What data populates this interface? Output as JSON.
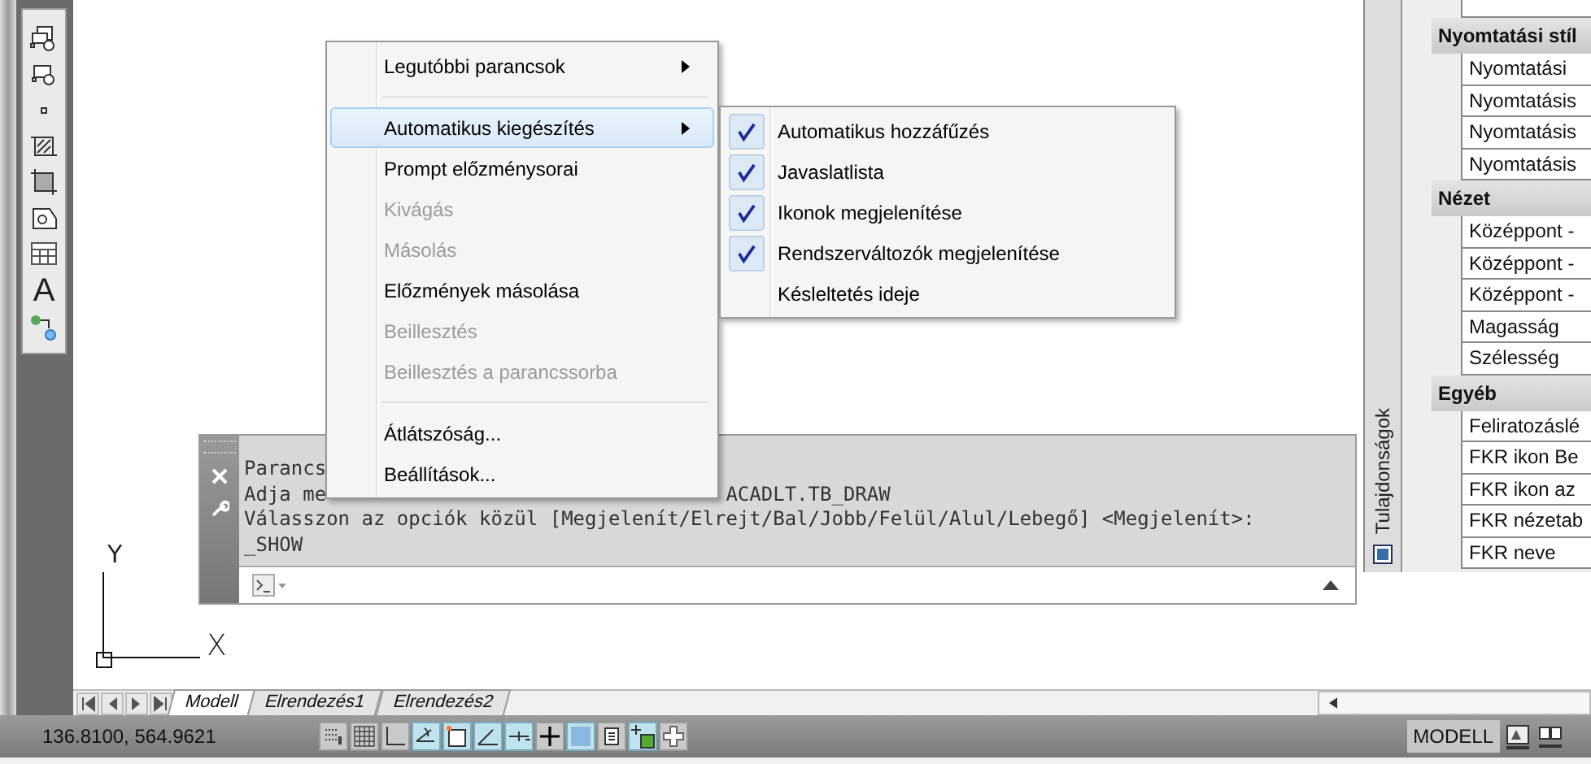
{
  "toolbar": [
    {
      "kind": "block-insert"
    },
    {
      "kind": "block"
    },
    {
      "kind": "point"
    },
    {
      "kind": "hatch"
    },
    {
      "kind": "gradient"
    },
    {
      "kind": "region"
    },
    {
      "kind": "table"
    },
    {
      "kind": "text",
      "label": "A"
    },
    {
      "kind": "attach"
    }
  ],
  "drawing": {
    "ucs_y": "Y",
    "ucs_x": "X"
  },
  "command_window": {
    "lines": [
      {
        "segments": [
          "Parancs"
        ]
      },
      {
        "segments": [
          "Adja me",
          "ACADLT.TB_DRAW"
        ]
      },
      {
        "segments": [
          "Válasszon az opciók közül [Megjelenít/Elrejt/Bal/Jobb/Felül/Alul/Lebegő] <Megjelenít>:"
        ]
      },
      {
        "segments": [
          "_SHOW"
        ]
      }
    ]
  },
  "properties": {
    "title": "Tulajdonságok",
    "groups": [
      {
        "name": "Nyomtatási stíl",
        "rows": [
          "Nyomtatási",
          "Nyomtatásis",
          "Nyomtatásis",
          "Nyomtatásis"
        ]
      },
      {
        "name": "Nézet",
        "rows": [
          "Középpont -",
          "Középpont -",
          "Középpont -",
          "Magasság",
          "Szélesség"
        ]
      },
      {
        "name": "Egyéb",
        "rows": [
          "Feliratozáslé",
          "FKR ikon Be",
          "FKR ikon az",
          "FKR nézetab",
          "FKR neve"
        ]
      }
    ]
  },
  "context_menu": {
    "items": [
      {
        "kind": "item",
        "label": "Legutóbbi parancsok",
        "disabled": false,
        "highlighted": false,
        "submenu": true
      },
      {
        "kind": "separator"
      },
      {
        "kind": "item",
        "label": "Automatikus kiegészítés",
        "disabled": false,
        "highlighted": true,
        "submenu": true
      },
      {
        "kind": "item",
        "label": "Prompt előzménysorai",
        "disabled": false,
        "highlighted": false,
        "submenu": false
      },
      {
        "kind": "item",
        "label": "Kivágás",
        "disabled": true,
        "highlighted": false,
        "submenu": false
      },
      {
        "kind": "item",
        "label": "Másolás",
        "disabled": true,
        "highlighted": false,
        "submenu": false
      },
      {
        "kind": "item",
        "label": "Előzmények másolása",
        "disabled": false,
        "highlighted": false,
        "submenu": false
      },
      {
        "kind": "item",
        "label": "Beillesztés",
        "disabled": true,
        "highlighted": false,
        "submenu": false
      },
      {
        "kind": "item",
        "label": "Beillesztés a parancssorba",
        "disabled": true,
        "highlighted": false,
        "submenu": false
      },
      {
        "kind": "separator"
      },
      {
        "kind": "item",
        "label": "Átlátszóság...",
        "disabled": false,
        "highlighted": false,
        "submenu": false
      },
      {
        "kind": "item",
        "label": "Beállítások...",
        "disabled": false,
        "highlighted": false,
        "submenu": false
      }
    ]
  },
  "submenu": {
    "items": [
      {
        "label": "Automatikus hozzáfűzés",
        "checked": true
      },
      {
        "label": "Javaslatlista",
        "checked": true
      },
      {
        "label": "Ikonok megjelenítése",
        "checked": true
      },
      {
        "label": "Rendszerváltozók megjelenítése",
        "checked": true
      },
      {
        "label": "Késleltetés ideje",
        "checked": false
      }
    ]
  },
  "layout_tabs": [
    {
      "label": "Modell",
      "selected": true
    },
    {
      "label": "Elrendezés1",
      "selected": false
    },
    {
      "label": "Elrendezés2",
      "selected": false
    }
  ],
  "status_bar": {
    "coordinates": "136.8100, 564.9621",
    "toggles": [
      {
        "kind": "infer",
        "on": false
      },
      {
        "kind": "grid",
        "on": false
      },
      {
        "kind": "ortho",
        "on": false
      },
      {
        "kind": "polar",
        "on": true
      },
      {
        "kind": "osnap",
        "on": true
      },
      {
        "kind": "angle",
        "on": true
      },
      {
        "kind": "ducs",
        "on": true
      },
      {
        "kind": "cross",
        "on": false
      },
      {
        "kind": "lineweight",
        "on": true
      },
      {
        "kind": "quick",
        "on": false
      },
      {
        "kind": "cycle",
        "on": true
      },
      {
        "kind": "plus",
        "on": false
      }
    ],
    "space": "MODELL"
  }
}
